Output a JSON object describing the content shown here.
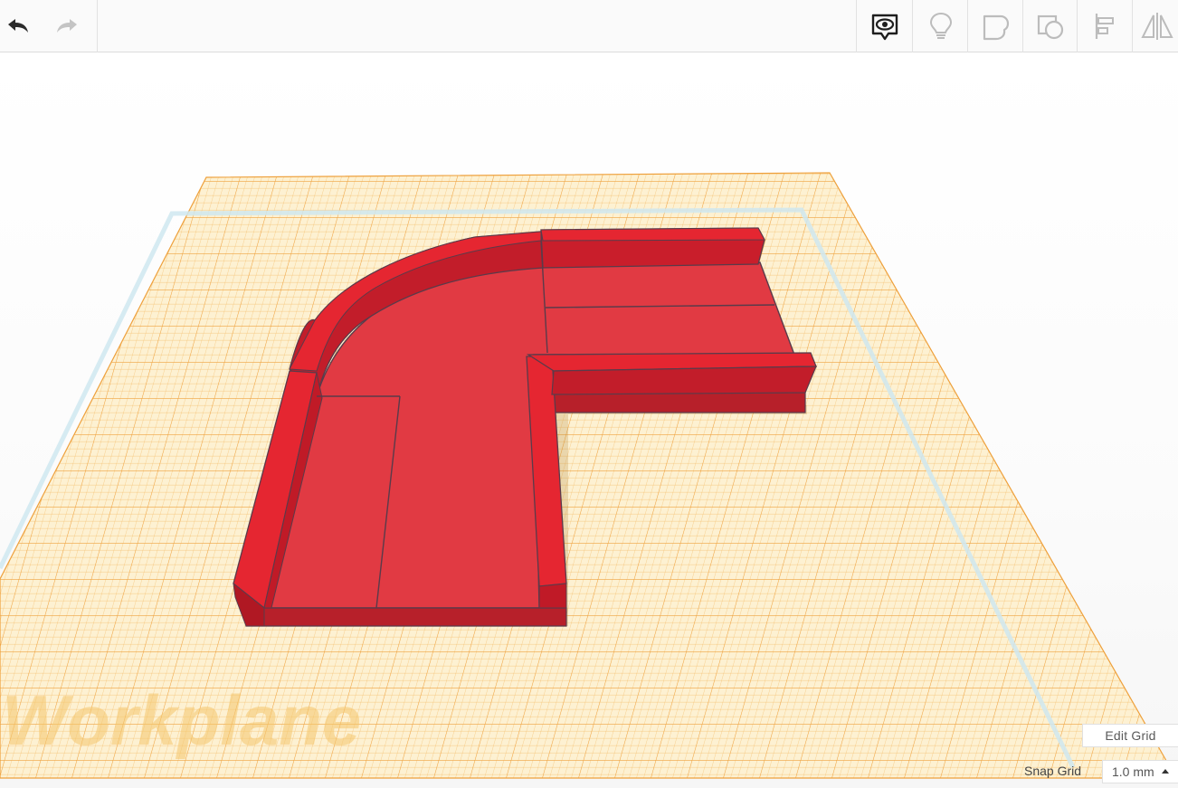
{
  "toolbar": {
    "undo": {
      "icon": "undo-arrow-icon",
      "enabled": true
    },
    "redo": {
      "icon": "redo-arrow-icon",
      "enabled": false
    },
    "tools": [
      {
        "name": "show-all-icon",
        "active": true
      },
      {
        "name": "lightbulb-icon",
        "active": false
      },
      {
        "name": "group-icon",
        "active": false
      },
      {
        "name": "ungroup-icon",
        "active": false
      },
      {
        "name": "align-icon",
        "active": false
      },
      {
        "name": "mirror-icon",
        "active": false
      }
    ]
  },
  "workplane": {
    "label": "Workplane",
    "grid_color": "#f0a43a",
    "plane_color": "#fdf0cf",
    "shape_color": "#e0202e"
  },
  "grid_controls": {
    "edit_grid_label": "Edit Grid",
    "snap_grid_label": "Snap Grid",
    "snap_value": "1.0 mm"
  }
}
